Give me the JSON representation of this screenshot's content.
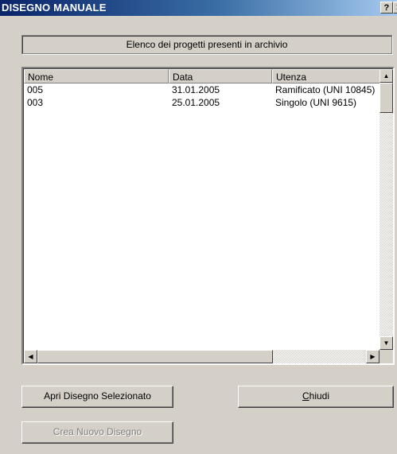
{
  "window": {
    "title": "DISEGNO MANUALE",
    "help_glyph": "?",
    "close_glyph": "✕"
  },
  "header": {
    "label": "Elenco dei progetti presenti in archivio"
  },
  "table": {
    "columns": [
      "Nome",
      "Data",
      "Utenza"
    ],
    "rows": [
      [
        "005",
        "31.01.2005",
        "Ramificato (UNI 10845)"
      ],
      [
        "003",
        "25.01.2005",
        "Singolo (UNI 9615)"
      ]
    ]
  },
  "scroll_icons": {
    "up": "▲",
    "down": "▼",
    "left": "◀",
    "right": "▶"
  },
  "buttons": {
    "open_selected": "Apri Disegno Selezionato",
    "close_mnemonic": "C",
    "close_rest": "hiudi",
    "create_new": "Crea Nuovo Disegno"
  }
}
